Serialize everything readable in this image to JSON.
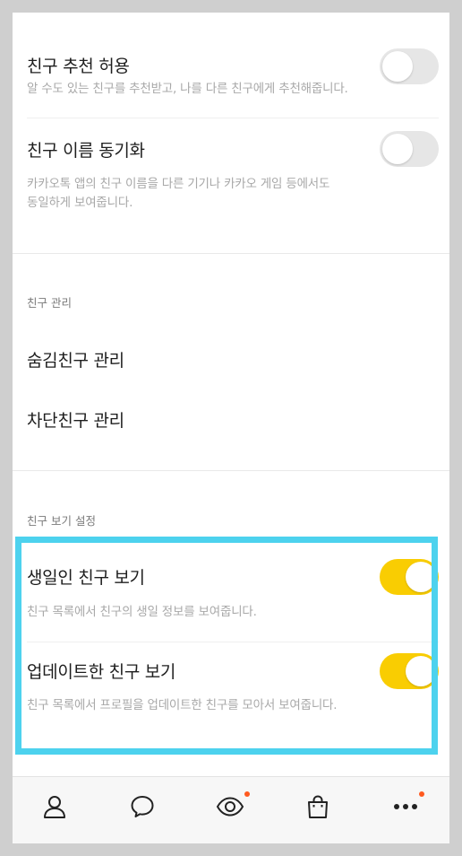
{
  "friends_settings": {
    "recommend": {
      "title": "친구 추천 허용",
      "desc": "알 수도 있는 친구를 추천받고, 나를 다른 친구에게 추천해줍니다.",
      "enabled": false
    },
    "name_sync": {
      "title": "친구 이름 동기화",
      "desc_line1": "카카오톡 앱의 친구 이름을 다른 기기나 카카오 게임 등에서도",
      "desc_line2": "동일하게 보여줍니다.",
      "enabled": false
    }
  },
  "manage_section": {
    "title": "친구 관리",
    "hidden_friends": "숨김친구 관리",
    "blocked_friends": "차단친구 관리"
  },
  "view_section": {
    "title": "친구 보기 설정",
    "birthday": {
      "title": "생일인 친구 보기",
      "desc": "친구 목록에서 친구의 생일 정보를 보여줍니다.",
      "enabled": true
    },
    "updated": {
      "title": "업데이트한 친구 보기",
      "desc": "친구 목록에서 프로필을 업데이트한 친구를 모아서 보여줍니다.",
      "enabled": true
    }
  },
  "tabbar": {
    "tabs": [
      {
        "icon": "person-icon",
        "badge": false
      },
      {
        "icon": "chat-bubble-icon",
        "badge": false
      },
      {
        "icon": "view-eye-icon",
        "badge": true
      },
      {
        "icon": "shopping-bag-icon",
        "badge": false
      },
      {
        "icon": "more-dots-icon",
        "badge": true
      }
    ]
  },
  "colors": {
    "toggle_on": "#f9cd02",
    "toggle_off": "#e6e6e6",
    "highlight_border": "#4dd2ee",
    "badge": "#ff5a1f"
  }
}
